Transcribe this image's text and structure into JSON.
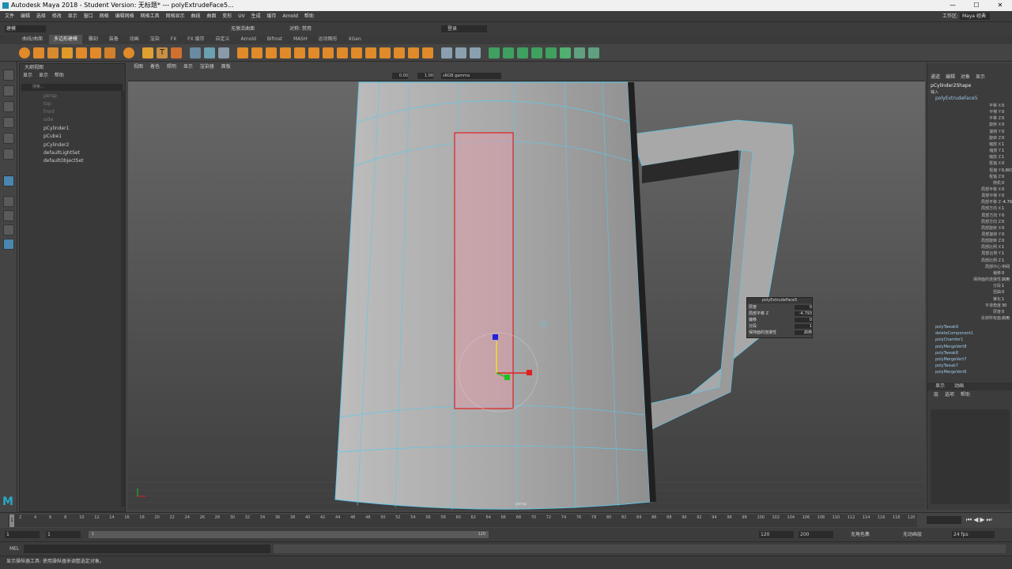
{
  "window": {
    "title": "Autodesk Maya 2018 - Student Version: 无标题*   ---   polyExtrudeFace5...",
    "minimize": "—",
    "maximize": "☐",
    "close": "✕"
  },
  "menubar": {
    "items": [
      "文件",
      "编辑",
      "选择",
      "修改",
      "显示",
      "窗口",
      "网格",
      "编辑网格",
      "网格工具",
      "网格显示",
      "曲线",
      "曲面",
      "变形",
      "UV",
      "生成",
      "缓存",
      "Arnold",
      "帮助"
    ],
    "workspace_label": "工作区:",
    "workspace_value": "Maya 经典"
  },
  "statusline": {
    "mode": "建模",
    "no_live": "无激活曲面",
    "symmetry": "对称: 禁用",
    "login": "登录"
  },
  "shelf": {
    "tabs": [
      "曲线/曲面",
      "多边形建模",
      "雕刻",
      "装备",
      "动画",
      "渲染",
      "FX",
      "FX 缓存",
      "自定义",
      "Arnold",
      "Bifrost",
      "MASH",
      "运动图形",
      "XGen"
    ],
    "active_tab": 1
  },
  "outliner": {
    "title": "大纲视图",
    "menu": [
      "显示",
      "显示",
      "帮助"
    ],
    "search_placeholder": "搜索...",
    "items": [
      "persp",
      "top",
      "front",
      "side",
      "pCylinder1",
      "pCube1",
      "pCylinder2",
      "defaultLightSet",
      "defaultObjectSet"
    ]
  },
  "viewport": {
    "menu": [
      "视图",
      "着色",
      "照明",
      "显示",
      "渲染器",
      "面板"
    ],
    "exposure": "0.00",
    "gamma": "1.00",
    "colorspace": "sRGB gamma",
    "camera_label": "persp"
  },
  "popup": {
    "title": "polyExtrudeFace5",
    "rows": [
      {
        "label": "厚度",
        "value": "0"
      },
      {
        "label": "局部平移 Z",
        "value": "-4.793"
      },
      {
        "label": "偏移",
        "value": "0"
      },
      {
        "label": "分段",
        "value": "1"
      },
      {
        "label": "保持面的连接性",
        "value": "启用"
      }
    ]
  },
  "channelbox": {
    "menu": [
      "通道",
      "编辑",
      "对象",
      "显示"
    ],
    "shape": "pCylinder2Shape",
    "inputs_label": "输入",
    "node": "polyExtrudeFace5",
    "attrs": [
      {
        "label": "平移 X",
        "value": "0"
      },
      {
        "label": "平移 Y",
        "value": "0"
      },
      {
        "label": "平移 Z",
        "value": "0"
      },
      {
        "label": "旋转 X",
        "value": "0"
      },
      {
        "label": "旋转 Y",
        "value": "0"
      },
      {
        "label": "旋转 Z",
        "value": "0"
      },
      {
        "label": "缩放 X",
        "value": "1"
      },
      {
        "label": "缩放 Y",
        "value": "1"
      },
      {
        "label": "缩放 Z",
        "value": "1"
      },
      {
        "label": "枢轴 X",
        "value": "0"
      },
      {
        "label": "枢轴 Y",
        "value": "6.807"
      },
      {
        "label": "枢轴 Z",
        "value": "0"
      },
      {
        "label": "随机",
        "value": "0"
      },
      {
        "label": "局部平移 X",
        "value": "0"
      },
      {
        "label": "局部平移 Y",
        "value": "0"
      },
      {
        "label": "局部平移 Z",
        "value": "-4.793"
      },
      {
        "label": "局部方向 X",
        "value": "1"
      },
      {
        "label": "局部方向 Y",
        "value": "0"
      },
      {
        "label": "局部方向 Z",
        "value": "0"
      },
      {
        "label": "局部旋转 X",
        "value": "0"
      },
      {
        "label": "局部旋转 Y",
        "value": "0"
      },
      {
        "label": "局部旋转 Z",
        "value": "0"
      },
      {
        "label": "局部比例 X",
        "value": "1"
      },
      {
        "label": "局部比例 Y",
        "value": "1"
      },
      {
        "label": "局部比例 Z",
        "value": "1"
      },
      {
        "label": "局部中心",
        "value": "中间"
      },
      {
        "label": "偏移",
        "value": "0"
      },
      {
        "label": "保持面的连接性",
        "value": "启用"
      },
      {
        "label": "分段",
        "value": "1"
      },
      {
        "label": "扭曲",
        "value": "0"
      },
      {
        "label": "锥化",
        "value": "1"
      },
      {
        "label": "平滑角度",
        "value": "30"
      },
      {
        "label": "厚度",
        "value": "0"
      },
      {
        "label": "反转所有面",
        "value": "启用"
      }
    ],
    "history": [
      "polyTweak9",
      "deleteComponent1",
      "polyChamfer1",
      "polyMergeVert8",
      "polyTweak8",
      "polyMergeVert7",
      "polyTweak7",
      "polyMergeVert6"
    ],
    "layer_tabs": [
      "显示",
      "动画"
    ],
    "layer_menu": [
      "层",
      "选项",
      "帮助"
    ]
  },
  "timeline": {
    "ticks": [
      "2",
      "4",
      "6",
      "8",
      "10",
      "12",
      "14",
      "16",
      "18",
      "20",
      "22",
      "24",
      "26",
      "28",
      "30",
      "32",
      "34",
      "36",
      "38",
      "40",
      "42",
      "44",
      "46",
      "48",
      "50",
      "52",
      "54",
      "56",
      "58",
      "60",
      "62",
      "64",
      "66",
      "68",
      "70",
      "72",
      "74",
      "76",
      "78",
      "80",
      "82",
      "84",
      "86",
      "88",
      "90",
      "92",
      "94",
      "96",
      "98",
      "100",
      "102",
      "104",
      "106",
      "108",
      "110",
      "112",
      "114",
      "116",
      "118",
      "120"
    ],
    "current_frame": "1",
    "range_start": "1",
    "range_inner_start": "1",
    "range_inner_end": "120",
    "anim_end": "120",
    "anim_end2": "200",
    "char_set": "无角色集",
    "anim_layer": "无动画层",
    "fps": "24 fps"
  },
  "cmdline": {
    "lang": "MEL"
  },
  "helpline": {
    "text": "显示操纵器工具: 使用操纵器来调整选定对象。"
  }
}
